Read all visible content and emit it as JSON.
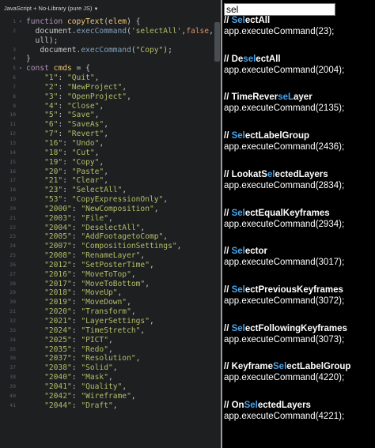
{
  "editor": {
    "header_label": "JavaScript + No-Library (pure JS)",
    "lines": [
      {
        "n": "1",
        "fold": "▾",
        "parts": [
          [
            "kw",
            "function "
          ],
          [
            "fn",
            "copyText"
          ],
          [
            "obj",
            "("
          ],
          [
            "fn",
            "elem"
          ],
          [
            "obj",
            ") {"
          ]
        ]
      },
      {
        "n": "2",
        "fold": "",
        "parts": [
          [
            "obj",
            "  document."
          ],
          [
            "meth",
            "execCommand"
          ],
          [
            "obj",
            "("
          ],
          [
            "str",
            "'selectAll'"
          ],
          [
            "obj",
            ","
          ],
          [
            "num",
            "false"
          ],
          [
            "obj",
            ",n"
          ]
        ]
      },
      {
        "n": "",
        "fold": "",
        "parts": [
          [
            "obj",
            "  ull);"
          ]
        ]
      },
      {
        "n": "3",
        "fold": "",
        "parts": [
          [
            "obj",
            "   document."
          ],
          [
            "meth",
            "execCommand"
          ],
          [
            "obj",
            "("
          ],
          [
            "str",
            "\"Copy\""
          ],
          [
            "obj",
            ");"
          ]
        ]
      },
      {
        "n": "4",
        "fold": "",
        "parts": [
          [
            "obj",
            "}"
          ]
        ]
      },
      {
        "n": "5",
        "fold": "▾",
        "parts": [
          [
            "kw",
            "const "
          ],
          [
            "fn",
            "cmds"
          ],
          [
            "obj",
            " = {"
          ]
        ]
      },
      {
        "n": "6",
        "fold": "",
        "parts": [
          [
            "str",
            "    \"1\""
          ],
          [
            "obj",
            ": "
          ],
          [
            "str",
            "\"Quit\""
          ],
          [
            "obj",
            ","
          ]
        ]
      },
      {
        "n": "7",
        "fold": "",
        "parts": [
          [
            "str",
            "    \"2\""
          ],
          [
            "obj",
            ": "
          ],
          [
            "str",
            "\"NewProject\""
          ],
          [
            "obj",
            ","
          ]
        ]
      },
      {
        "n": "8",
        "fold": "",
        "parts": [
          [
            "str",
            "    \"3\""
          ],
          [
            "obj",
            ": "
          ],
          [
            "str",
            "\"OpenProject\""
          ],
          [
            "obj",
            ","
          ]
        ]
      },
      {
        "n": "9",
        "fold": "",
        "parts": [
          [
            "str",
            "    \"4\""
          ],
          [
            "obj",
            ": "
          ],
          [
            "str",
            "\"Close\""
          ],
          [
            "obj",
            ","
          ]
        ]
      },
      {
        "n": "10",
        "fold": "",
        "parts": [
          [
            "str",
            "    \"5\""
          ],
          [
            "obj",
            ": "
          ],
          [
            "str",
            "\"Save\""
          ],
          [
            "obj",
            ","
          ]
        ]
      },
      {
        "n": "11",
        "fold": "",
        "parts": [
          [
            "str",
            "    \"6\""
          ],
          [
            "obj",
            ": "
          ],
          [
            "str",
            "\"SaveAs\""
          ],
          [
            "obj",
            ","
          ]
        ]
      },
      {
        "n": "12",
        "fold": "",
        "parts": [
          [
            "str",
            "    \"7\""
          ],
          [
            "obj",
            ": "
          ],
          [
            "str",
            "\"Revert\""
          ],
          [
            "obj",
            ","
          ]
        ]
      },
      {
        "n": "13",
        "fold": "",
        "parts": [
          [
            "str",
            "    \"16\""
          ],
          [
            "obj",
            ": "
          ],
          [
            "str",
            "\"Undo\""
          ],
          [
            "obj",
            ","
          ]
        ]
      },
      {
        "n": "14",
        "fold": "",
        "parts": [
          [
            "str",
            "    \"18\""
          ],
          [
            "obj",
            ": "
          ],
          [
            "str",
            "\"Cut\""
          ],
          [
            "obj",
            ","
          ]
        ]
      },
      {
        "n": "15",
        "fold": "",
        "parts": [
          [
            "str",
            "    \"19\""
          ],
          [
            "obj",
            ": "
          ],
          [
            "str",
            "\"Copy\""
          ],
          [
            "obj",
            ","
          ]
        ]
      },
      {
        "n": "16",
        "fold": "",
        "parts": [
          [
            "str",
            "    \"20\""
          ],
          [
            "obj",
            ": "
          ],
          [
            "str",
            "\"Paste\""
          ],
          [
            "obj",
            ","
          ]
        ]
      },
      {
        "n": "17",
        "fold": "",
        "parts": [
          [
            "str",
            "    \"21\""
          ],
          [
            "obj",
            ": "
          ],
          [
            "str",
            "\"Clear\""
          ],
          [
            "obj",
            ","
          ]
        ]
      },
      {
        "n": "18",
        "fold": "",
        "parts": [
          [
            "str",
            "    \"23\""
          ],
          [
            "obj",
            ": "
          ],
          [
            "str",
            "\"SelectAll\""
          ],
          [
            "obj",
            ","
          ]
        ]
      },
      {
        "n": "19",
        "fold": "",
        "parts": [
          [
            "str",
            "    \"53\""
          ],
          [
            "obj",
            ": "
          ],
          [
            "str",
            "\"CopyExpressionOnly\""
          ],
          [
            "obj",
            ","
          ]
        ]
      },
      {
        "n": "20",
        "fold": "",
        "parts": [
          [
            "str",
            "    \"2000\""
          ],
          [
            "obj",
            ": "
          ],
          [
            "str",
            "\"NewComposition\""
          ],
          [
            "obj",
            ","
          ]
        ]
      },
      {
        "n": "21",
        "fold": "",
        "parts": [
          [
            "str",
            "    \"2003\""
          ],
          [
            "obj",
            ": "
          ],
          [
            "str",
            "\"File\""
          ],
          [
            "obj",
            ","
          ]
        ]
      },
      {
        "n": "22",
        "fold": "",
        "parts": [
          [
            "str",
            "    \"2004\""
          ],
          [
            "obj",
            ": "
          ],
          [
            "str",
            "\"DeselectAll\""
          ],
          [
            "obj",
            ","
          ]
        ]
      },
      {
        "n": "23",
        "fold": "",
        "parts": [
          [
            "str",
            "    \"2005\""
          ],
          [
            "obj",
            ": "
          ],
          [
            "str",
            "\"AddFootagetoComp\""
          ],
          [
            "obj",
            ","
          ]
        ]
      },
      {
        "n": "24",
        "fold": "",
        "parts": [
          [
            "str",
            "    \"2007\""
          ],
          [
            "obj",
            ": "
          ],
          [
            "str",
            "\"CompositionSettings\""
          ],
          [
            "obj",
            ","
          ]
        ]
      },
      {
        "n": "25",
        "fold": "",
        "parts": [
          [
            "str",
            "    \"2008\""
          ],
          [
            "obj",
            ": "
          ],
          [
            "str",
            "\"RenameLayer\""
          ],
          [
            "obj",
            ","
          ]
        ]
      },
      {
        "n": "26",
        "fold": "",
        "parts": [
          [
            "str",
            "    \"2012\""
          ],
          [
            "obj",
            ": "
          ],
          [
            "str",
            "\"SetPosterTime\""
          ],
          [
            "obj",
            ","
          ]
        ]
      },
      {
        "n": "27",
        "fold": "",
        "parts": [
          [
            "str",
            "    \"2016\""
          ],
          [
            "obj",
            ": "
          ],
          [
            "str",
            "\"MoveToTop\""
          ],
          [
            "obj",
            ","
          ]
        ]
      },
      {
        "n": "28",
        "fold": "",
        "parts": [
          [
            "str",
            "    \"2017\""
          ],
          [
            "obj",
            ": "
          ],
          [
            "str",
            "\"MoveToBottom\""
          ],
          [
            "obj",
            ","
          ]
        ]
      },
      {
        "n": "29",
        "fold": "",
        "parts": [
          [
            "str",
            "    \"2018\""
          ],
          [
            "obj",
            ": "
          ],
          [
            "str",
            "\"MoveUp\""
          ],
          [
            "obj",
            ","
          ]
        ]
      },
      {
        "n": "30",
        "fold": "",
        "parts": [
          [
            "str",
            "    \"2019\""
          ],
          [
            "obj",
            ": "
          ],
          [
            "str",
            "\"MoveDown\""
          ],
          [
            "obj",
            ","
          ]
        ]
      },
      {
        "n": "31",
        "fold": "",
        "parts": [
          [
            "str",
            "    \"2020\""
          ],
          [
            "obj",
            ": "
          ],
          [
            "str",
            "\"Transform\""
          ],
          [
            "obj",
            ","
          ]
        ]
      },
      {
        "n": "32",
        "fold": "",
        "parts": [
          [
            "str",
            "    \"2021\""
          ],
          [
            "obj",
            ": "
          ],
          [
            "str",
            "\"LayerSettings\""
          ],
          [
            "obj",
            ","
          ]
        ]
      },
      {
        "n": "33",
        "fold": "",
        "parts": [
          [
            "str",
            "    \"2024\""
          ],
          [
            "obj",
            ": "
          ],
          [
            "str",
            "\"TimeStretch\""
          ],
          [
            "obj",
            ","
          ]
        ]
      },
      {
        "n": "34",
        "fold": "",
        "parts": [
          [
            "str",
            "    \"2025\""
          ],
          [
            "obj",
            ": "
          ],
          [
            "str",
            "\"PICT\""
          ],
          [
            "obj",
            ","
          ]
        ]
      },
      {
        "n": "35",
        "fold": "",
        "parts": [
          [
            "str",
            "    \"2035\""
          ],
          [
            "obj",
            ": "
          ],
          [
            "str",
            "\"Redo\""
          ],
          [
            "obj",
            ","
          ]
        ]
      },
      {
        "n": "36",
        "fold": "",
        "parts": [
          [
            "str",
            "    \"2037\""
          ],
          [
            "obj",
            ": "
          ],
          [
            "str",
            "\"Resolution\""
          ],
          [
            "obj",
            ","
          ]
        ]
      },
      {
        "n": "37",
        "fold": "",
        "parts": [
          [
            "str",
            "    \"2038\""
          ],
          [
            "obj",
            ": "
          ],
          [
            "str",
            "\"Solid\""
          ],
          [
            "obj",
            ","
          ]
        ]
      },
      {
        "n": "38",
        "fold": "",
        "parts": [
          [
            "str",
            "    \"2040\""
          ],
          [
            "obj",
            ": "
          ],
          [
            "str",
            "\"Mask\""
          ],
          [
            "obj",
            ","
          ]
        ]
      },
      {
        "n": "39",
        "fold": "",
        "parts": [
          [
            "str",
            "    \"2041\""
          ],
          [
            "obj",
            ": "
          ],
          [
            "str",
            "\"Quality\""
          ],
          [
            "obj",
            ","
          ]
        ]
      },
      {
        "n": "40",
        "fold": "",
        "parts": [
          [
            "str",
            "    \"2042\""
          ],
          [
            "obj",
            ": "
          ],
          [
            "str",
            "\"Wireframe\""
          ],
          [
            "obj",
            ","
          ]
        ]
      },
      {
        "n": "41",
        "fold": "",
        "parts": [
          [
            "str",
            "    \"2044\""
          ],
          [
            "obj",
            ": "
          ],
          [
            "str",
            "\"Draft\""
          ],
          [
            "obj",
            ","
          ]
        ]
      }
    ]
  },
  "result": {
    "search_value": "sel",
    "entries": [
      {
        "title": [
          [
            "// ",
            ""
          ],
          [
            "Sel",
            "hl"
          ],
          [
            "ectAll",
            ""
          ]
        ],
        "code": "app.executeCommand(23);"
      },
      {
        "title": [
          [
            "// De",
            ""
          ],
          [
            "sel",
            "hl"
          ],
          [
            "ectAll",
            ""
          ]
        ],
        "code": "app.executeCommand(2004);"
      },
      {
        "title": [
          [
            "// TimeRever",
            ""
          ],
          [
            "seL",
            "hl"
          ],
          [
            "ayer",
            ""
          ]
        ],
        "code": "app.executeCommand(2135);"
      },
      {
        "title": [
          [
            "// ",
            ""
          ],
          [
            "Sel",
            "hl"
          ],
          [
            "ectLabelGroup",
            ""
          ]
        ],
        "code": "app.executeCommand(2436);"
      },
      {
        "title": [
          [
            "// LookatS",
            ""
          ],
          [
            "el",
            "hl"
          ],
          [
            "ectedLayers",
            ""
          ]
        ],
        "code": "app.executeCommand(2834);"
      },
      {
        "title": [
          [
            "// ",
            ""
          ],
          [
            "Sel",
            "hl"
          ],
          [
            "ectEqualKeyframes",
            ""
          ]
        ],
        "code": "app.executeCommand(2934);"
      },
      {
        "title": [
          [
            "// ",
            ""
          ],
          [
            "Sel",
            "hl"
          ],
          [
            "ector",
            ""
          ]
        ],
        "code": "app.executeCommand(3017);"
      },
      {
        "title": [
          [
            "// ",
            ""
          ],
          [
            "Sel",
            "hl"
          ],
          [
            "ectPreviousKeyframes",
            ""
          ]
        ],
        "code": "app.executeCommand(3072);"
      },
      {
        "title": [
          [
            "// ",
            ""
          ],
          [
            "Sel",
            "hl"
          ],
          [
            "ectFollowingKeyframes",
            ""
          ]
        ],
        "code": "app.executeCommand(3073);"
      },
      {
        "title": [
          [
            "// Keyframe",
            ""
          ],
          [
            "Sel",
            "hl"
          ],
          [
            "ectLabelGroup",
            ""
          ]
        ],
        "code": "app.executeCommand(4220);"
      },
      {
        "title": [
          [
            "// On",
            ""
          ],
          [
            "Sel",
            "hl"
          ],
          [
            "ectedLayers",
            ""
          ]
        ],
        "code": "app.executeCommand(4221);"
      }
    ]
  }
}
